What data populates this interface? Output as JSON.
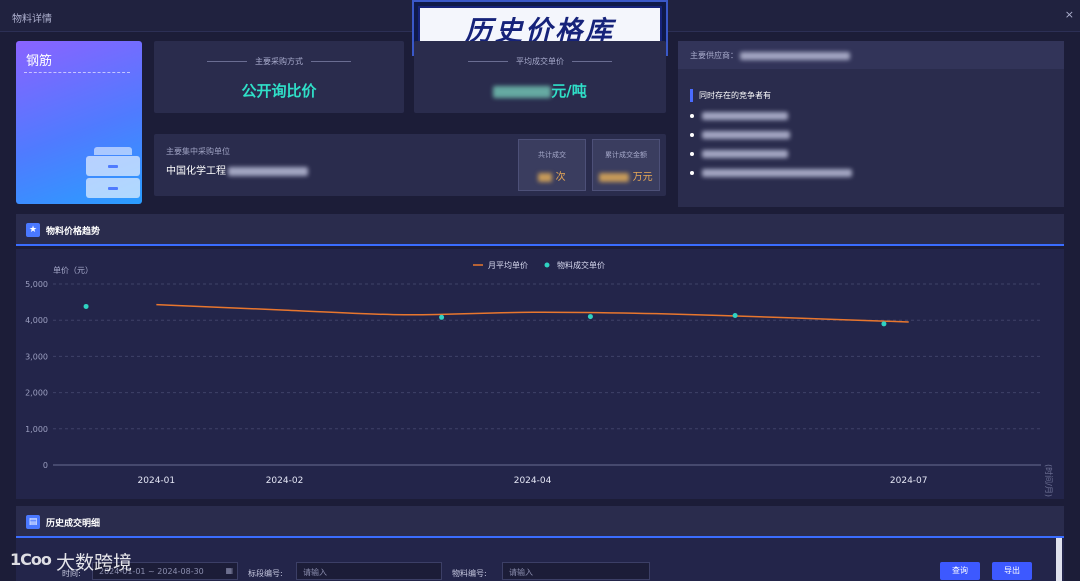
{
  "window": {
    "title": "物料详情",
    "close_glyph": "×"
  },
  "banner": {
    "text": "历史价格库"
  },
  "material": {
    "name": "钢筋",
    "icon": "drawer-cabinet-icon"
  },
  "stats": {
    "purchase_method_label": "主要采购方式",
    "purchase_method_value": "公开询比价",
    "avg_price_label": "平均成交单价",
    "avg_price_unit": "元/吨"
  },
  "org": {
    "label": "主要集中采购单位",
    "name_prefix": "中国化学工程",
    "total_deals_label": "共计成交",
    "total_deals_unit": "次",
    "total_amount_label": "累计成交金额",
    "total_amount_unit": "万元"
  },
  "suppliers": {
    "main_label": "主要供应商：",
    "competitors_title": "同时存在的竞争者有"
  },
  "trend": {
    "title": "物料价格趋势",
    "icon": "star-icon"
  },
  "history": {
    "title": "历史成交明细",
    "icon": "document-icon"
  },
  "filters": {
    "time_label": "时间:",
    "time_value": "2024-01-01 ~ 2024-08-30",
    "calendar_icon": "calendar-icon",
    "bid_no_label": "标段编号:",
    "bid_no_placeholder": "请输入",
    "material_no_label": "物料编号:",
    "material_no_placeholder": "请输入",
    "query_label": "查询",
    "export_label": "导出"
  },
  "watermark": {
    "logo": "1Coo",
    "text": "大数跨境"
  },
  "chart_data": {
    "type": "line",
    "ylabel": "单价（元）",
    "xlabel": "(时间/月)",
    "ylim": [
      0,
      5000
    ],
    "yticks": [
      "0",
      "1,000",
      "2,000",
      "3,000",
      "4,000",
      "5,000"
    ],
    "xticks": [
      "2024-01",
      "2024-02",
      "2024-04",
      "2024-07"
    ],
    "grid": true,
    "legend": "top-center",
    "colors": {
      "line": "#e8762e",
      "points": "#2fd2c2"
    },
    "series": [
      {
        "name": "月平均单价",
        "type": "line",
        "x": [
          "2024-01",
          "2024-02",
          "2024-03",
          "2024-04",
          "2024-05",
          "2024-06",
          "2024-07"
        ],
        "values": [
          4430,
          4280,
          4150,
          4220,
          4180,
          4070,
          3950
        ]
      },
      {
        "name": "物料成交单价",
        "type": "scatter",
        "x": [
          "2023-12-15",
          "2024-03-10",
          "2024-04-15",
          "2024-05-20",
          "2024-06-25"
        ],
        "values": [
          4380,
          4080,
          4100,
          4130,
          3900
        ]
      }
    ]
  }
}
